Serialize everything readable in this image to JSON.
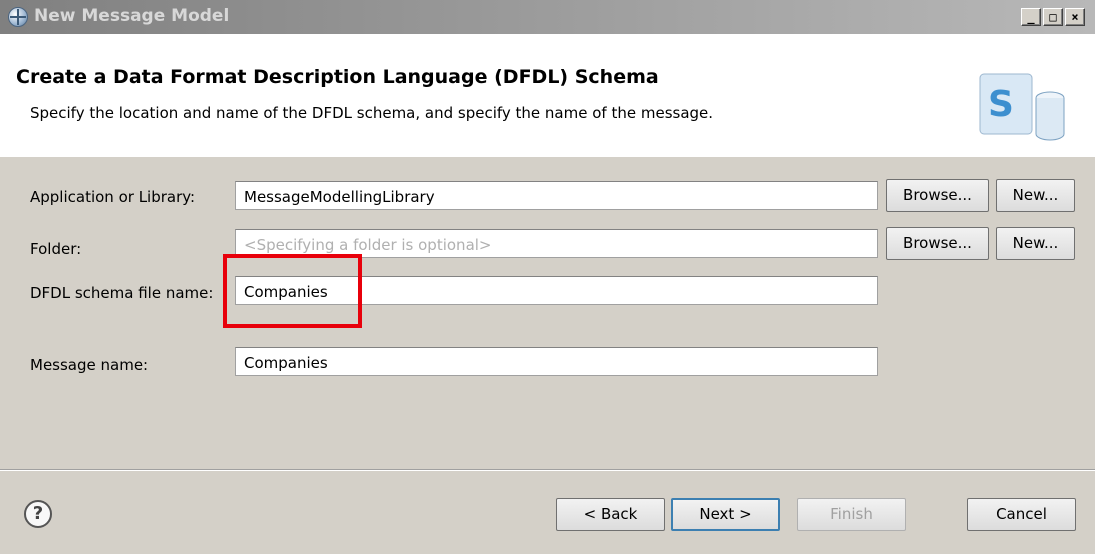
{
  "window": {
    "title": "New Message Model",
    "minimize_glyph": "_",
    "maximize_glyph": "□",
    "close_glyph": "×",
    "app_icon": "globe-icon"
  },
  "header": {
    "title": "Create a Data Format Description Language (DFDL) Schema",
    "description": "Specify the location and name of the DFDL schema, and specify the name of the message.",
    "wizard_icon": "dfdl-schema-icon"
  },
  "form": {
    "application": {
      "label": "Application or Library:",
      "value": "MessageModellingLibrary",
      "browse_label": "Browse...",
      "new_label": "New..."
    },
    "folder": {
      "label": "Folder:",
      "placeholder": "<Specifying a folder is optional>",
      "browse_label": "Browse...",
      "new_label": "New..."
    },
    "schema_file": {
      "label": "DFDL schema file name:",
      "value": "Companies"
    },
    "message_name": {
      "label": "Message name:",
      "value": "Companies"
    }
  },
  "footer": {
    "help_glyph": "?",
    "back_label": "< Back",
    "next_label": "Next >",
    "finish_label": "Finish",
    "cancel_label": "Cancel"
  },
  "colors": {
    "highlight_box": "#e8000b",
    "default_button_border": "#3c7fb1",
    "dialog_background": "#d4d0c8"
  }
}
